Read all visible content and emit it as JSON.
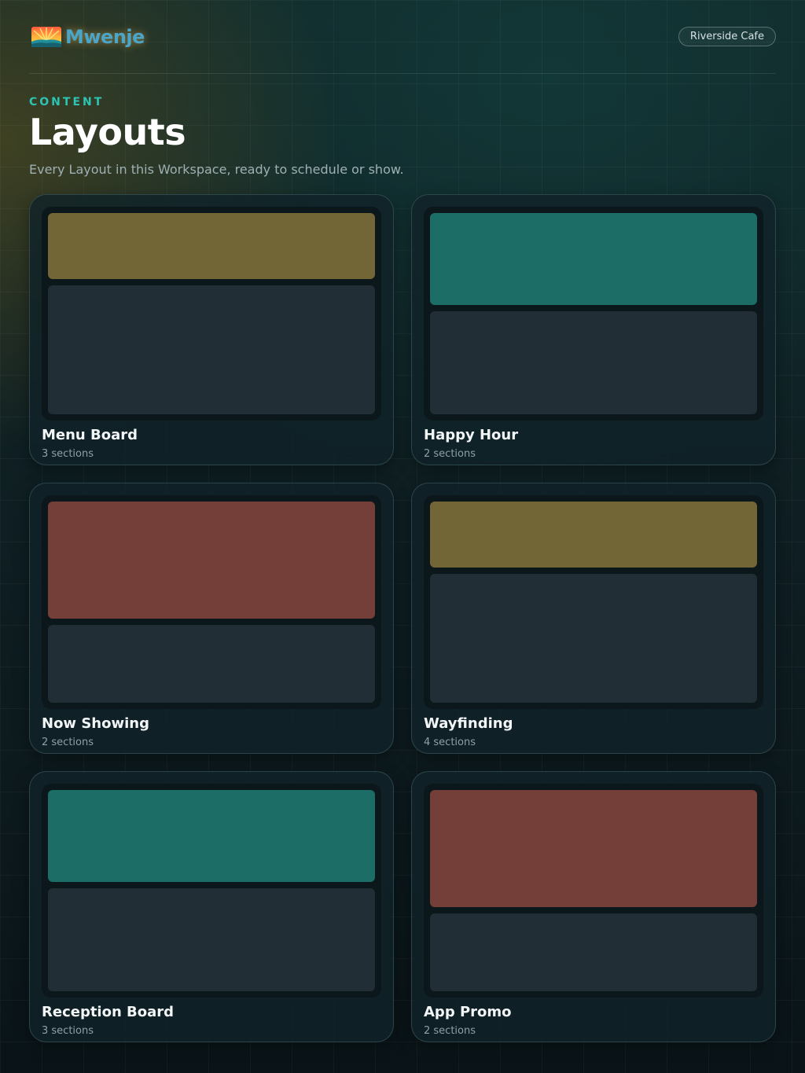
{
  "brand": {
    "name": "Mwenje",
    "logo_icon": "sunrise-logo-icon"
  },
  "workspace": {
    "label": "Riverside Cafe"
  },
  "section_label": "CONTENT",
  "title": "Layouts",
  "subtitle": "Every Layout in this Workspace, ready to schedule or show.",
  "colors": {
    "accent": "#2cc4b3",
    "olive": "#736636",
    "teal": "#1b6d66",
    "rust": "#733f38",
    "slate": "#222e35"
  },
  "layouts": [
    {
      "name": "Menu Board",
      "sections": "3 sections",
      "accent_color": "#736636",
      "top_fraction": 0.34
    },
    {
      "name": "Happy Hour",
      "sections": "2 sections",
      "accent_color": "#1b6d66",
      "top_fraction": 0.47
    },
    {
      "name": "Now Showing",
      "sections": "2 sections",
      "accent_color": "#733f38",
      "top_fraction": 0.6
    },
    {
      "name": "Wayfinding",
      "sections": "4 sections",
      "accent_color": "#736636",
      "top_fraction": 0.34
    },
    {
      "name": "Reception Board",
      "sections": "3 sections",
      "accent_color": "#1b6d66",
      "top_fraction": 0.47
    },
    {
      "name": "App Promo",
      "sections": "2 sections",
      "accent_color": "#733f38",
      "top_fraction": 0.6
    }
  ]
}
